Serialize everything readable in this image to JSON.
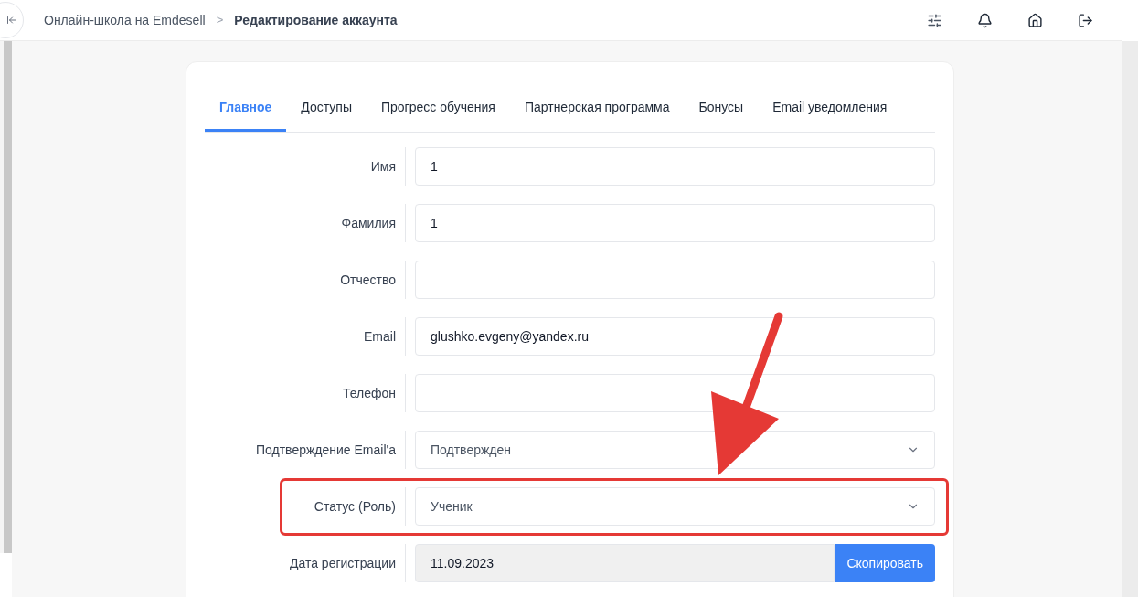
{
  "breadcrumb": {
    "parent": "Онлайн-школа на Emdesell",
    "separator": ">",
    "current": "Редактирование аккаунта"
  },
  "tabs": [
    {
      "label": "Главное",
      "selected": true
    },
    {
      "label": "Доступы",
      "selected": false
    },
    {
      "label": "Прогресс обучения",
      "selected": false
    },
    {
      "label": "Партнерская программа",
      "selected": false
    },
    {
      "label": "Бонусы",
      "selected": false
    },
    {
      "label": "Email уведомления",
      "selected": false
    }
  ],
  "fields": [
    {
      "kind": "text",
      "label": "Имя",
      "value": "1"
    },
    {
      "kind": "text",
      "label": "Фамилия",
      "value": "1"
    },
    {
      "kind": "text",
      "label": "Отчество"
    },
    {
      "kind": "text",
      "label": "Email",
      "value": "glushko.evgeny@yandex.ru"
    },
    {
      "kind": "text",
      "label": "Телефон"
    },
    {
      "kind": "select",
      "label": "Подтверждение Email'а",
      "value": "Подтвержден"
    },
    {
      "kind": "select",
      "label": "Статус (Роль)",
      "value": "Ученик",
      "highlighted": true
    },
    {
      "kind": "readonly",
      "label": "Дата регистрации",
      "value": "11.09.2023",
      "button": "Скопировать"
    }
  ]
}
